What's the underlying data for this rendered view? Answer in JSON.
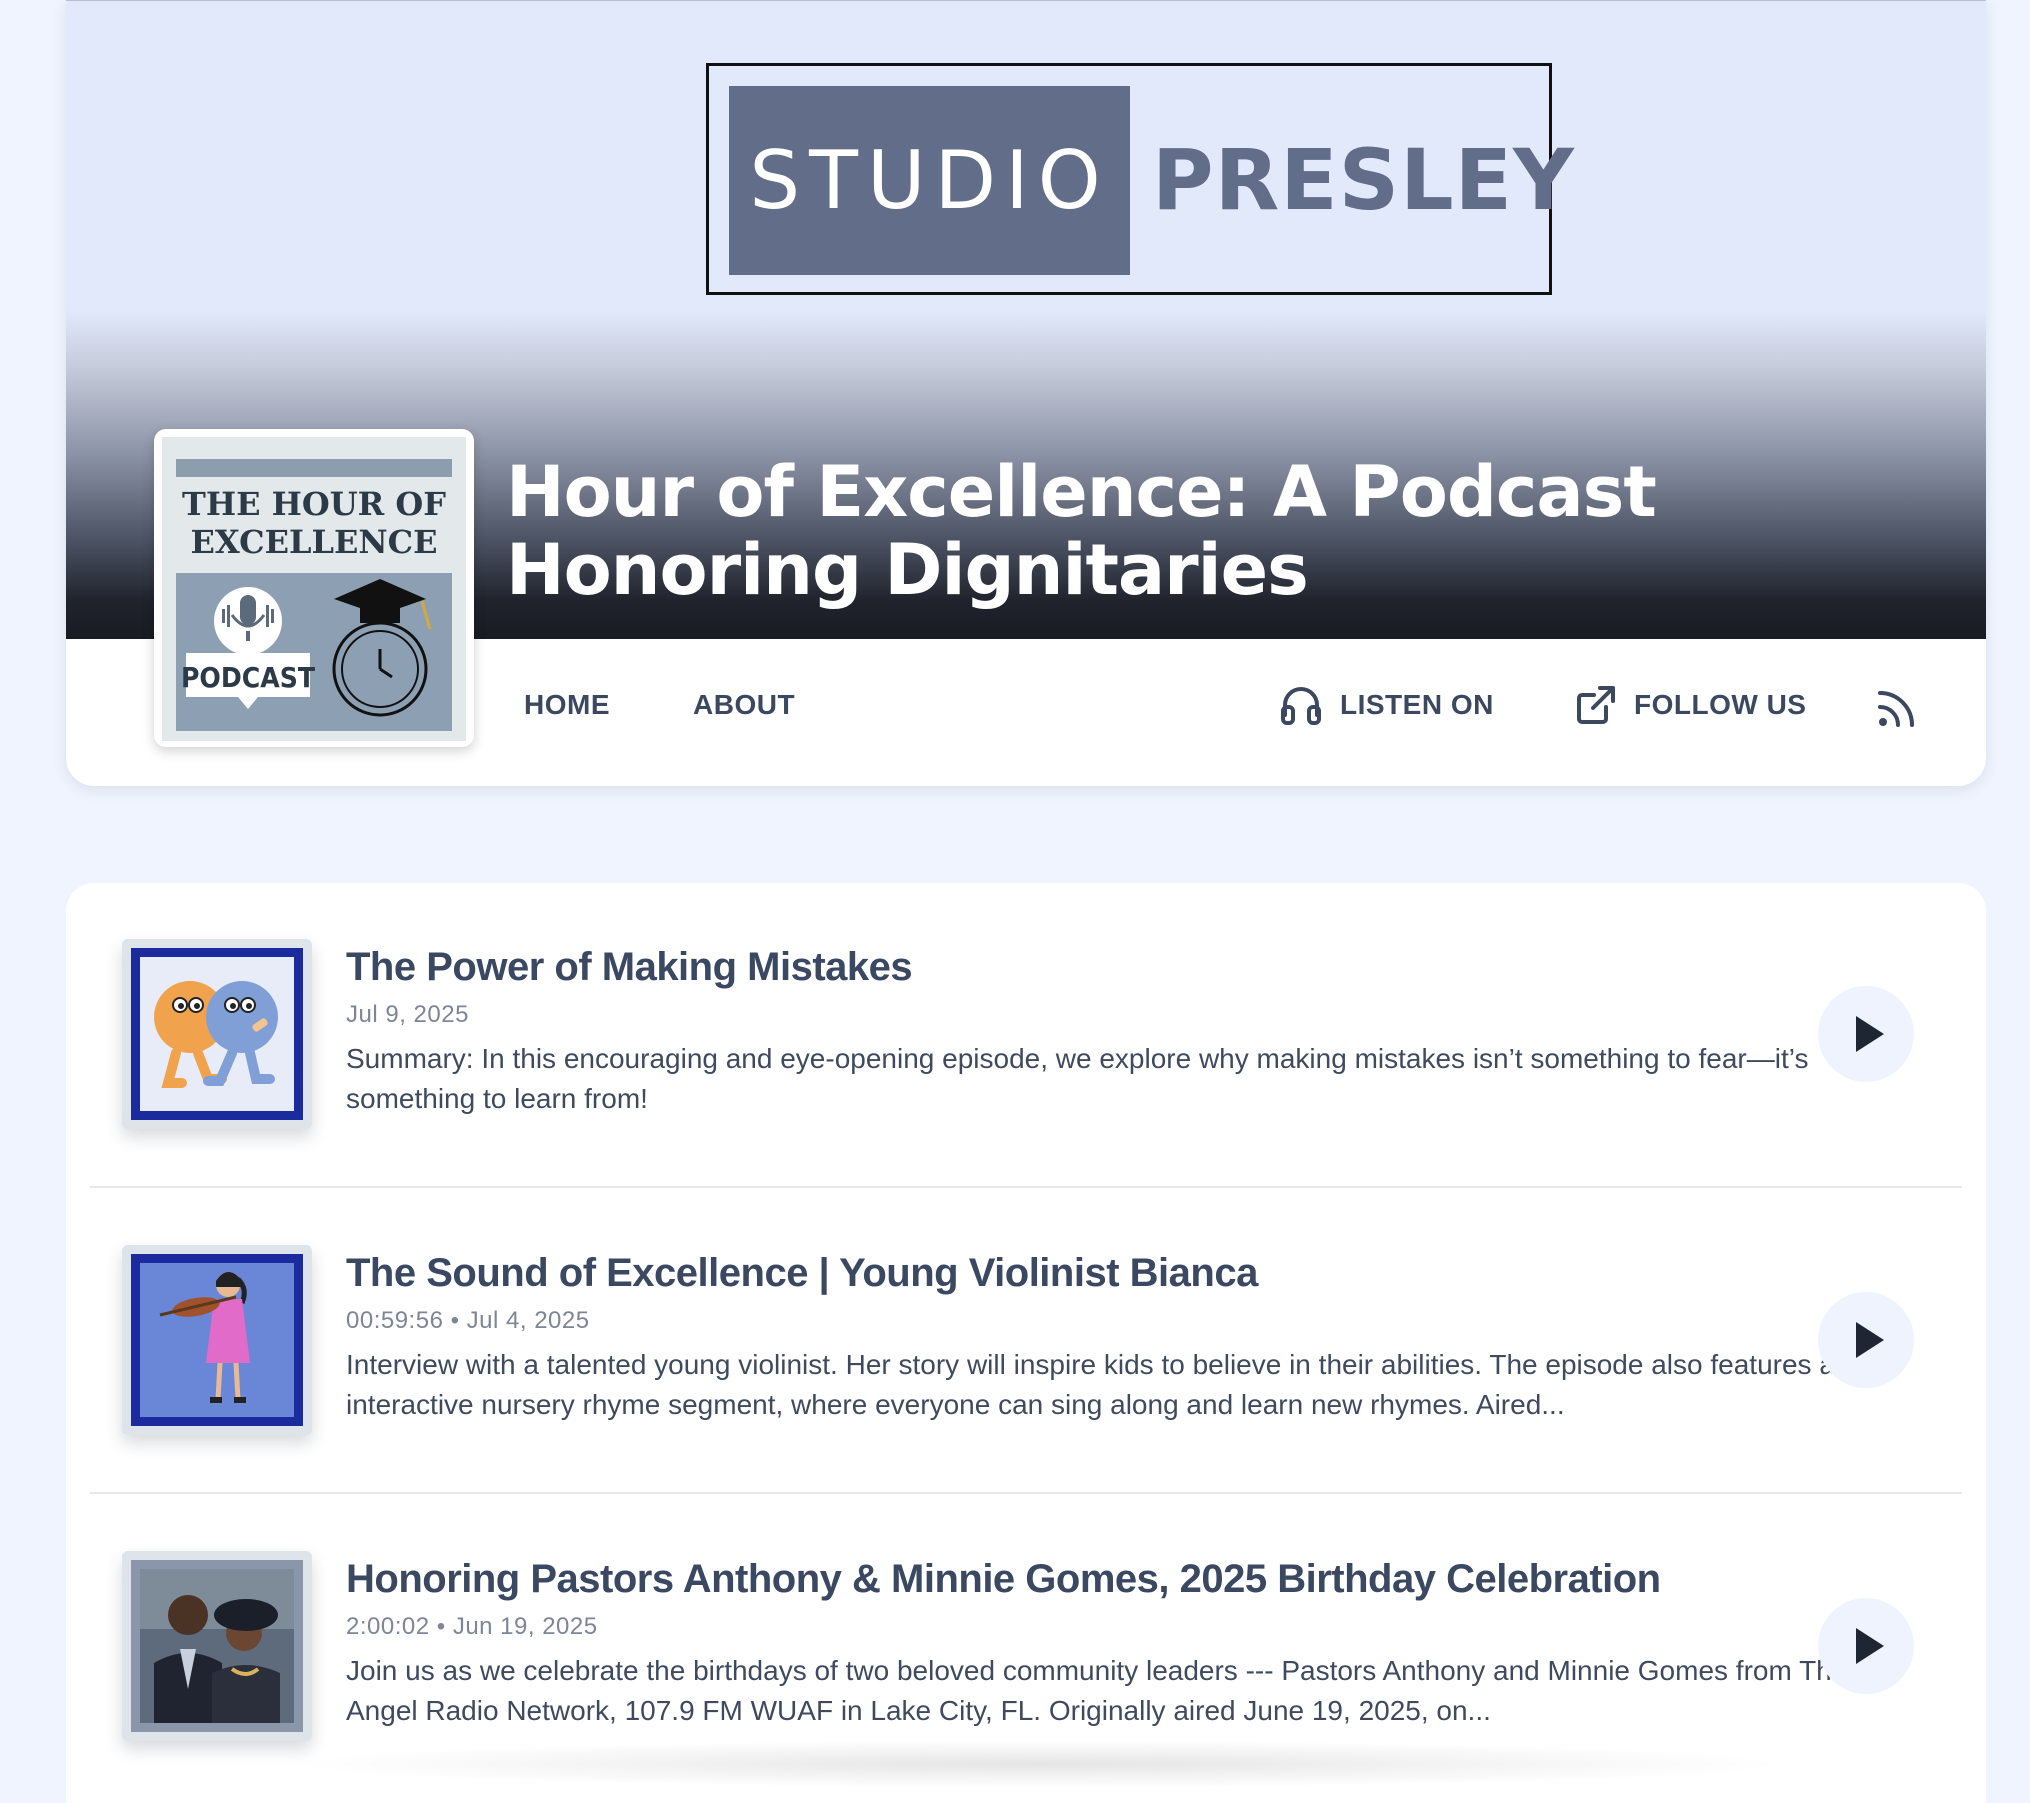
{
  "logo": {
    "studio": "STUDIO",
    "presley": "PRESLEY"
  },
  "show": {
    "title": "Hour of Excellence: A Podcast Honoring Dignitaries",
    "cover": {
      "title_line1": "THE HOUR OF",
      "title_line2": "EXCELLENCE",
      "badge": "PODCAST"
    }
  },
  "nav": {
    "home": "HOME",
    "about": "ABOUT",
    "listen_on": "LISTEN ON",
    "follow_us": "FOLLOW US",
    "listen_icon": "headphones-icon",
    "follow_icon": "external-link-icon",
    "rss_icon": "rss-icon"
  },
  "episodes": [
    {
      "title": "The Power of Making Mistakes",
      "meta": "Jul 9, 2025",
      "summary": "Summary: In this encouraging and eye-opening episode, we explore why making mistakes isn’t something to fear—it’s something to learn from!"
    },
    {
      "title": "The Sound of Excellence | Young Violinist Bianca",
      "meta": "00:59:56 • Jul 4, 2025",
      "summary": "Interview with a talented young violinist. Her story will inspire kids to believe in their abilities. The episode also features an interactive nursery rhyme segment, where everyone can sing along and learn new rhymes. Aired..."
    },
    {
      "title": "Honoring Pastors Anthony & Minnie Gomes, 2025 Birthday Celebration",
      "meta": "2:00:02 • Jun 19, 2025",
      "summary": "Join us as we celebrate the birthdays of two beloved community leaders --- Pastors Anthony and Minnie Gomes from The Angel Radio Network, 107.9 FM WUAF in Lake City, FL. Originally aired June 19, 2025, on..."
    }
  ],
  "colors": {
    "page_bg": "#eff4fe",
    "banner_light": "#e1e9fb",
    "banner_dark": "#191b22",
    "logo_slate": "#626d89",
    "text_primary": "#3b4862",
    "text_muted": "#7d8596",
    "play_bg": "#eef3fd",
    "play_icon": "#1f2633"
  }
}
